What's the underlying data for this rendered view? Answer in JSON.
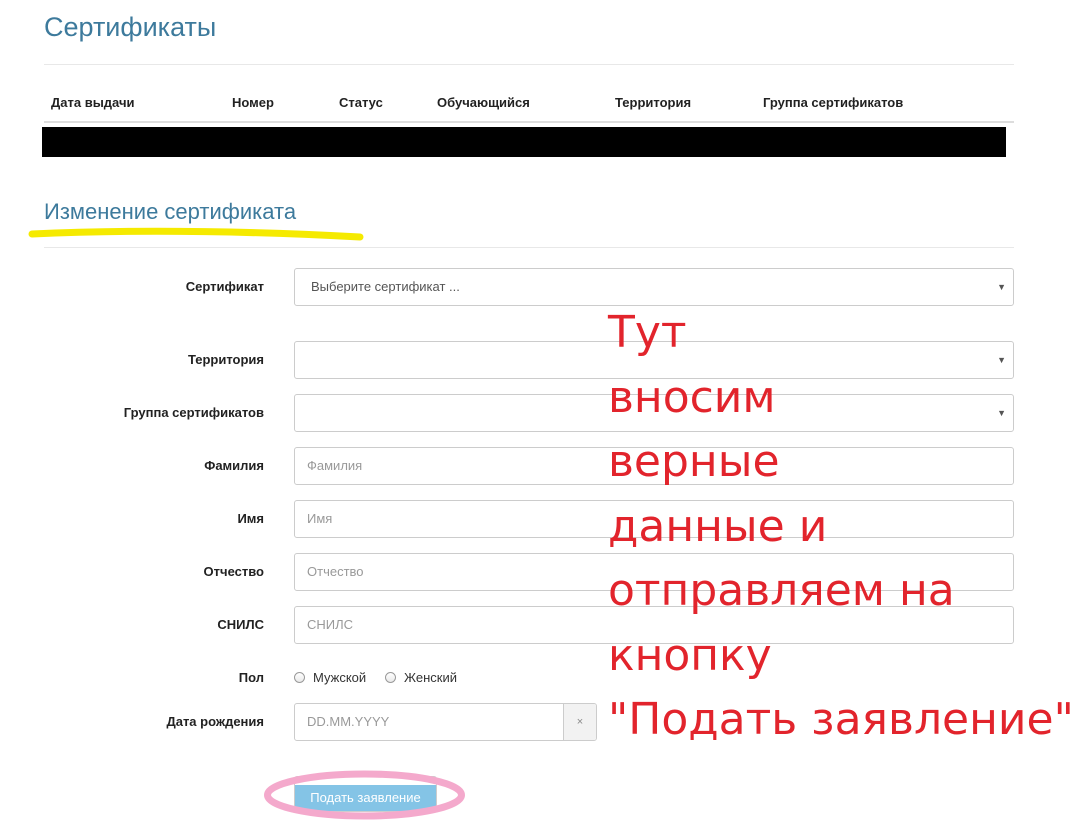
{
  "certificates": {
    "title": "Сертификаты",
    "columns": [
      "Дата выдачи",
      "Номер",
      "Статус",
      "Обучающийся",
      "Территория",
      "Группа сертификатов"
    ]
  },
  "form": {
    "title": "Изменение сертификата",
    "certificate": {
      "label": "Сертификат",
      "value": "Выберите сертификат ..."
    },
    "territory": {
      "label": "Территория",
      "value": ""
    },
    "group": {
      "label": "Группа сертификатов",
      "value": ""
    },
    "last_name": {
      "label": "Фамилия",
      "placeholder": "Фамилия"
    },
    "first_name": {
      "label": "Имя",
      "placeholder": "Имя"
    },
    "patronymic": {
      "label": "Отчество",
      "placeholder": "Отчество"
    },
    "snils": {
      "label": "СНИЛС",
      "placeholder": "СНИЛС"
    },
    "gender": {
      "label": "Пол",
      "options": [
        "Мужской",
        "Женский"
      ]
    },
    "birth_date": {
      "label": "Дата рождения",
      "placeholder": "DD.MM.YYYY",
      "clear_glyph": "×"
    },
    "submit_label": "Подать заявление"
  },
  "annotation": {
    "lines": [
      "Тут",
      "вносим",
      "верные",
      "данные и",
      "отправляем на",
      "кнопку",
      "\"Подать заявление\""
    ]
  },
  "colors": {
    "heading": "#3d7a9c",
    "annotation": "#e2242c",
    "highlighter": "#f5ea00",
    "circle": "#f4a9cc",
    "button": "#84c4e6"
  }
}
